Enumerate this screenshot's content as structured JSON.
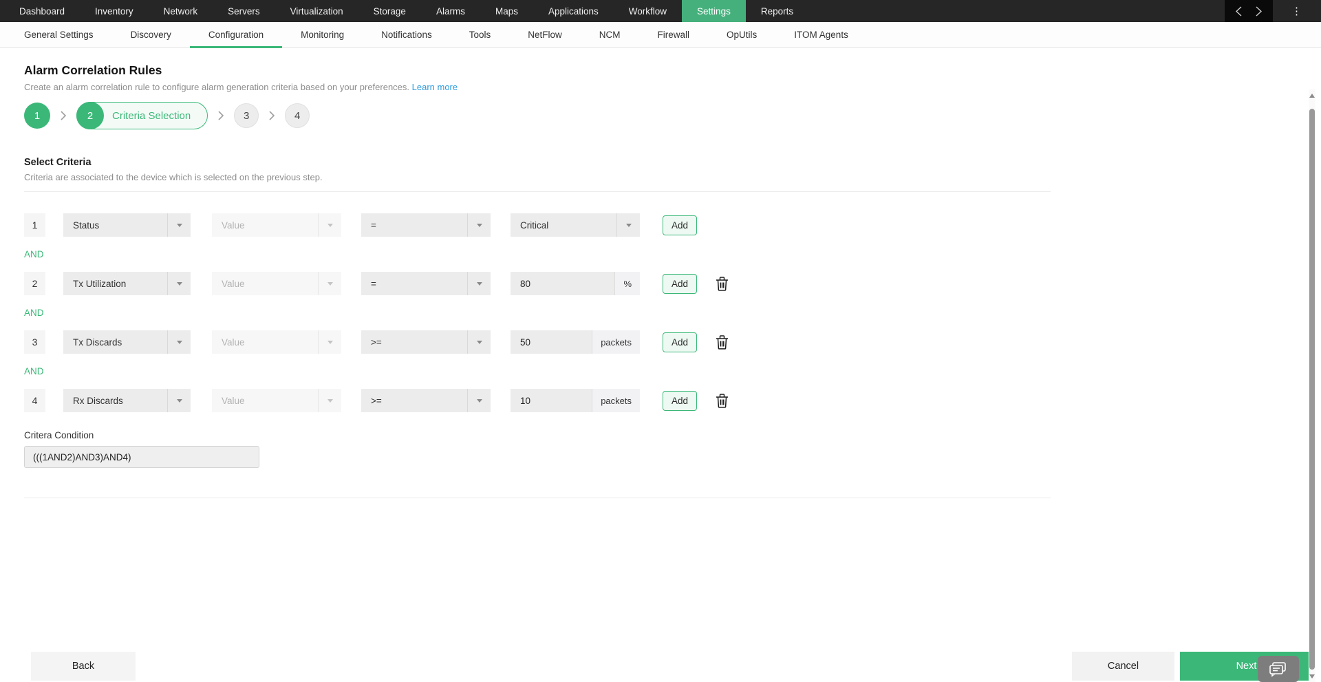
{
  "navbar": {
    "items": [
      "Dashboard",
      "Inventory",
      "Network",
      "Servers",
      "Virtualization",
      "Storage",
      "Alarms",
      "Maps",
      "Applications",
      "Workflow",
      "Settings",
      "Reports"
    ],
    "active_item": "Settings"
  },
  "tabbar": {
    "items": [
      "General Settings",
      "Discovery",
      "Configuration",
      "Monitoring",
      "Notifications",
      "Tools",
      "NetFlow",
      "NCM",
      "Firewall",
      "OpUtils",
      "ITOM Agents"
    ],
    "active_item": "Configuration"
  },
  "page": {
    "title": "Alarm Correlation Rules",
    "description": "Create an alarm correlation rule to configure alarm generation criteria based on your preferences.",
    "learn_more": "Learn more"
  },
  "wizard": {
    "steps": [
      {
        "number": "1",
        "state": "done"
      },
      {
        "number": "2",
        "label": "Criteria Selection",
        "state": "active"
      },
      {
        "number": "3",
        "state": "pending"
      },
      {
        "number": "4",
        "state": "pending"
      }
    ]
  },
  "criteria": {
    "heading": "Select Criteria",
    "subheading": "Criteria are associated to the device which is selected on the previous step.",
    "connector": "AND",
    "add_label": "Add",
    "value_placeholder": "Value",
    "rows": [
      {
        "index": "1",
        "field": "Status",
        "operator": "=",
        "value": "Critical",
        "unit": ""
      },
      {
        "index": "2",
        "field": "Tx Utilization",
        "operator": "=",
        "value": "80",
        "unit": "%"
      },
      {
        "index": "3",
        "field": "Tx Discards",
        "operator": ">=",
        "value": "50",
        "unit": "packets"
      },
      {
        "index": "4",
        "field": "Rx Discards",
        "operator": ">=",
        "value": "10",
        "unit": "packets"
      }
    ],
    "condition_label": "Critera Condition",
    "condition_value": "(((1AND2)AND3)AND4)"
  },
  "footer": {
    "back_label": "Back",
    "cancel_label": "Cancel",
    "next_label": "Next"
  },
  "colors": {
    "primary_green": "#3bb878",
    "link_blue": "#2d9cdb",
    "navbar_bg": "#262626"
  }
}
